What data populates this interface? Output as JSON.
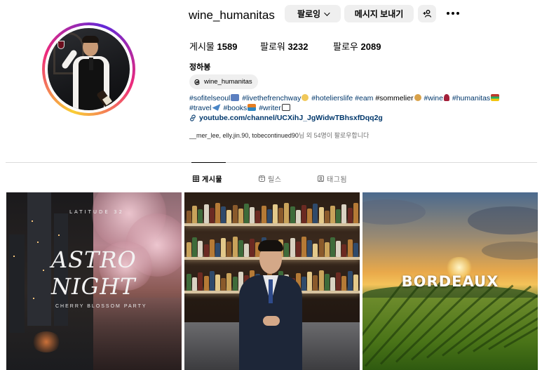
{
  "profile": {
    "username": "wine_humanitas",
    "full_name": "정하봉",
    "threads_handle": "wine_humanitas"
  },
  "actions": {
    "following_label": "팔로잉",
    "message_label": "메시지 보내기"
  },
  "stats": {
    "posts_label": "게시물",
    "posts_count": "1589",
    "followers_label": "팔로워",
    "followers_count": "3232",
    "following_label": "팔로우",
    "following_count": "2089"
  },
  "bio": {
    "line1": {
      "tag1": "#sofitelseoul",
      "tag2": "#livethefrenchway",
      "tag3": "#hotelierslife",
      "tag4": "#eam",
      "tag5": "#sommelier",
      "tag6": "#wine",
      "tag7": "#humanitas"
    },
    "line2": {
      "tag1": "#travel",
      "tag2": "#books",
      "tag3": "#writer"
    },
    "link": "youtube.com/channel/UCXihJ_JgWidwTBhsxfDqq2g"
  },
  "followed_by": {
    "names": "__mer_lee, elly.jin.90, tobecontinued90",
    "suffix": "님 외 54명이 팔로우합니다"
  },
  "tabs": [
    {
      "label": "게시물",
      "active": true
    },
    {
      "label": "릴스",
      "active": false
    },
    {
      "label": "태그됨",
      "active": false
    }
  ],
  "posts": [
    {
      "overlay_top": "LATITUDE 32",
      "title_line1": "ASTRO",
      "title_line2": "NIGHT",
      "subtitle": "CHERRY BLOSSOM PARTY"
    },
    {},
    {
      "title": "BORDEAUX"
    }
  ],
  "colors": {
    "link_blue": "#00376b",
    "button_gray": "#efefef",
    "muted_text": "#737373",
    "divider": "#dbdbdb"
  },
  "icons": {
    "more": "more-icon",
    "suggest": "add-person-icon",
    "threads": "threads-icon",
    "link": "link-icon",
    "grid": "grid-icon",
    "reels": "reels-icon",
    "tagged": "tagged-icon"
  }
}
